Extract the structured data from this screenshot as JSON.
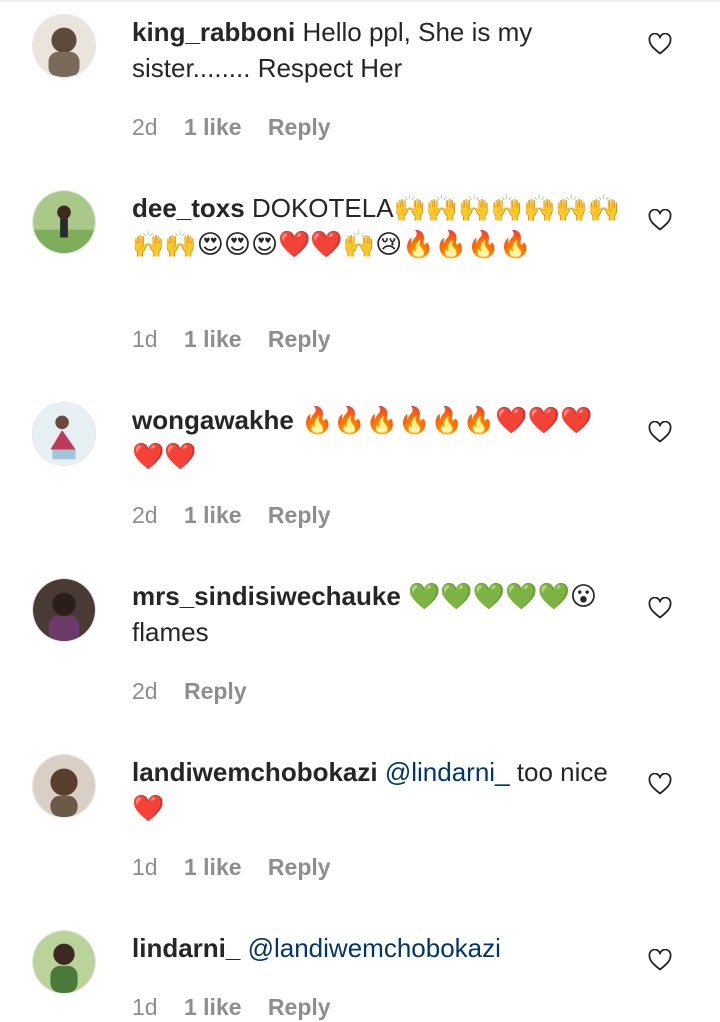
{
  "comments": [
    {
      "username": "king_rabboni",
      "text": "Hello ppl, She is my sister........ Respect Her",
      "mention": "",
      "time": "2d",
      "likes": "1 like",
      "reply": "Reply",
      "avatar_color": "#7a6a5a"
    },
    {
      "username": "dee_toxs",
      "text": "DOKOTELA🙌🙌🙌🙌🙌🙌🙌🙌🙌😍😍😍❤️❤️🙌😢🔥🔥🔥🔥",
      "mention": "",
      "time": "1d",
      "likes": "1 like",
      "reply": "Reply",
      "avatar_color": "#7fae5a"
    },
    {
      "username": "wongawakhe",
      "text": "🔥🔥🔥🔥🔥🔥❤️❤️❤️❤️❤️",
      "mention": "",
      "time": "2d",
      "likes": "1 like",
      "reply": "Reply",
      "avatar_color": "#cde2ea"
    },
    {
      "username": "mrs_sindisiwechauke",
      "text": "💚💚💚💚💚😮flames",
      "mention": "",
      "time": "2d",
      "likes": "",
      "reply": "Reply",
      "avatar_color": "#3a2c2a"
    },
    {
      "username": "landiwemchobokazi",
      "text": "too nice ❤️",
      "mention": "@lindarni_",
      "time": "1d",
      "likes": "1 like",
      "reply": "Reply",
      "avatar_color": "#6b5a4a"
    },
    {
      "username": "lindarni_",
      "text": "",
      "mention": "@landiwemchobokazi",
      "time": "1d",
      "likes": "1 like",
      "reply": "Reply",
      "avatar_color": "#4a7a3a"
    }
  ],
  "icons": {
    "heart": "heart-icon",
    "avatar": "avatar"
  },
  "colors": {
    "username": "#262626",
    "mention": "#00376b",
    "meta": "#8e8e8e"
  }
}
